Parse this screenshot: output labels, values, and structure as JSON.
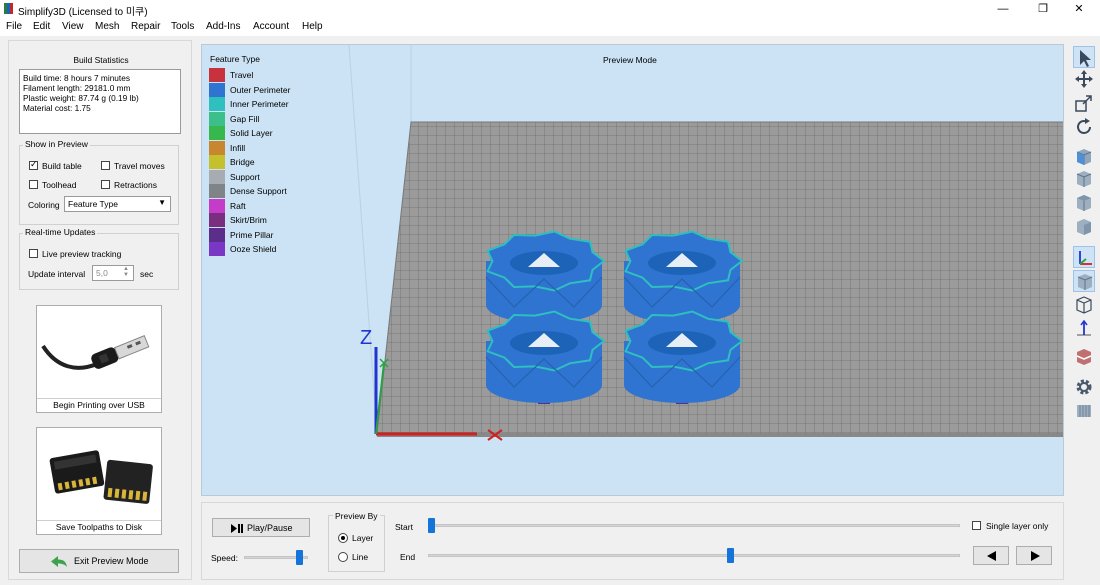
{
  "window": {
    "title": "Simplify3D (Licensed to 미쿠)",
    "minimize": "—",
    "maximize": "❐",
    "close": "✕"
  },
  "menu": [
    "File",
    "Edit",
    "View",
    "Mesh",
    "Repair",
    "Tools",
    "Add-Ins",
    "Account",
    "Help"
  ],
  "build_statistics": {
    "title": "Build Statistics",
    "lines": [
      "Build time: 8 hours 7 minutes",
      "Filament length: 29181.0 mm",
      "Plastic weight: 87.74 g (0.19 lb)",
      "Material cost: 1.75"
    ]
  },
  "show_in_preview": {
    "title": "Show in Preview",
    "build_table": {
      "label": "Build table",
      "checked": true
    },
    "travel_moves": {
      "label": "Travel moves",
      "checked": false
    },
    "toolhead": {
      "label": "Toolhead",
      "checked": false
    },
    "retractions": {
      "label": "Retractions",
      "checked": false
    },
    "coloring_label": "Coloring",
    "coloring_value": "Feature Type"
  },
  "realtime_updates": {
    "title": "Real-time Updates",
    "live_tracking": {
      "label": "Live preview tracking",
      "checked": false
    },
    "interval_label": "Update interval",
    "interval_value": "5,0",
    "interval_unit": "sec"
  },
  "usb_button": {
    "label": "Begin Printing over USB",
    "icon": "usb-cable-icon"
  },
  "disk_button": {
    "label": "Save Toolpaths to Disk",
    "icon": "sd-card-icon"
  },
  "exit_button": {
    "label": "Exit Preview Mode",
    "icon": "back-arrow-icon"
  },
  "viewport": {
    "mode_label": "Preview Mode",
    "axis_z_label": "Z",
    "legend": {
      "title": "Feature Type",
      "items": [
        {
          "label": "Travel",
          "color": "#c8323c"
        },
        {
          "label": "Outer Perimeter",
          "color": "#2f74d0"
        },
        {
          "label": "Inner Perimeter",
          "color": "#2ebfbf"
        },
        {
          "label": "Gap Fill",
          "color": "#3cbf8a"
        },
        {
          "label": "Solid Layer",
          "color": "#36b84f"
        },
        {
          "label": "Infill",
          "color": "#c8862f"
        },
        {
          "label": "Bridge",
          "color": "#c4c02e"
        },
        {
          "label": "Support",
          "color": "#a7acb2"
        },
        {
          "label": "Dense Support",
          "color": "#7f8489"
        },
        {
          "label": "Raft",
          "color": "#c43cc8"
        },
        {
          "label": "Skirt/Brim",
          "color": "#7a2e7f"
        },
        {
          "label": "Prime Pillar",
          "color": "#5a2e8a"
        },
        {
          "label": "Ooze Shield",
          "color": "#7a36c4"
        }
      ]
    }
  },
  "right_toolbar": [
    {
      "icon": "select-arrow-icon",
      "active": true
    },
    {
      "icon": "move-icon",
      "active": false
    },
    {
      "icon": "scale-icon",
      "active": false
    },
    {
      "icon": "rotate-icon",
      "active": false
    },
    {
      "icon": "view-iso-cube-icon",
      "active": false
    },
    {
      "icon": "view-front-cube-icon",
      "active": false
    },
    {
      "icon": "view-top-cube-icon",
      "active": false
    },
    {
      "icon": "view-side-cube-icon",
      "active": false
    },
    {
      "icon": "axes-icon",
      "active": true
    },
    {
      "icon": "solid-cube-icon",
      "active": true
    },
    {
      "icon": "wireframe-cube-icon",
      "active": false
    },
    {
      "icon": "normals-icon",
      "active": false
    },
    {
      "icon": "cross-section-icon",
      "active": false
    },
    {
      "icon": "settings-gear-icon",
      "active": false
    },
    {
      "icon": "bed-icon",
      "active": false
    }
  ],
  "bottom": {
    "play_pause": "Play/Pause",
    "speed_label": "Speed:",
    "preview_by_title": "Preview By",
    "layer_label": "Layer",
    "line_label": "Line",
    "preview_by_selected": "Layer",
    "start_label": "Start",
    "end_label": "End",
    "single_layer": {
      "label": "Single layer only",
      "checked": false
    },
    "speed_value": 0.92,
    "start_value": 0.0,
    "end_value": 0.57,
    "prev_icon": "prev-layer-icon",
    "next_icon": "next-layer-icon"
  }
}
